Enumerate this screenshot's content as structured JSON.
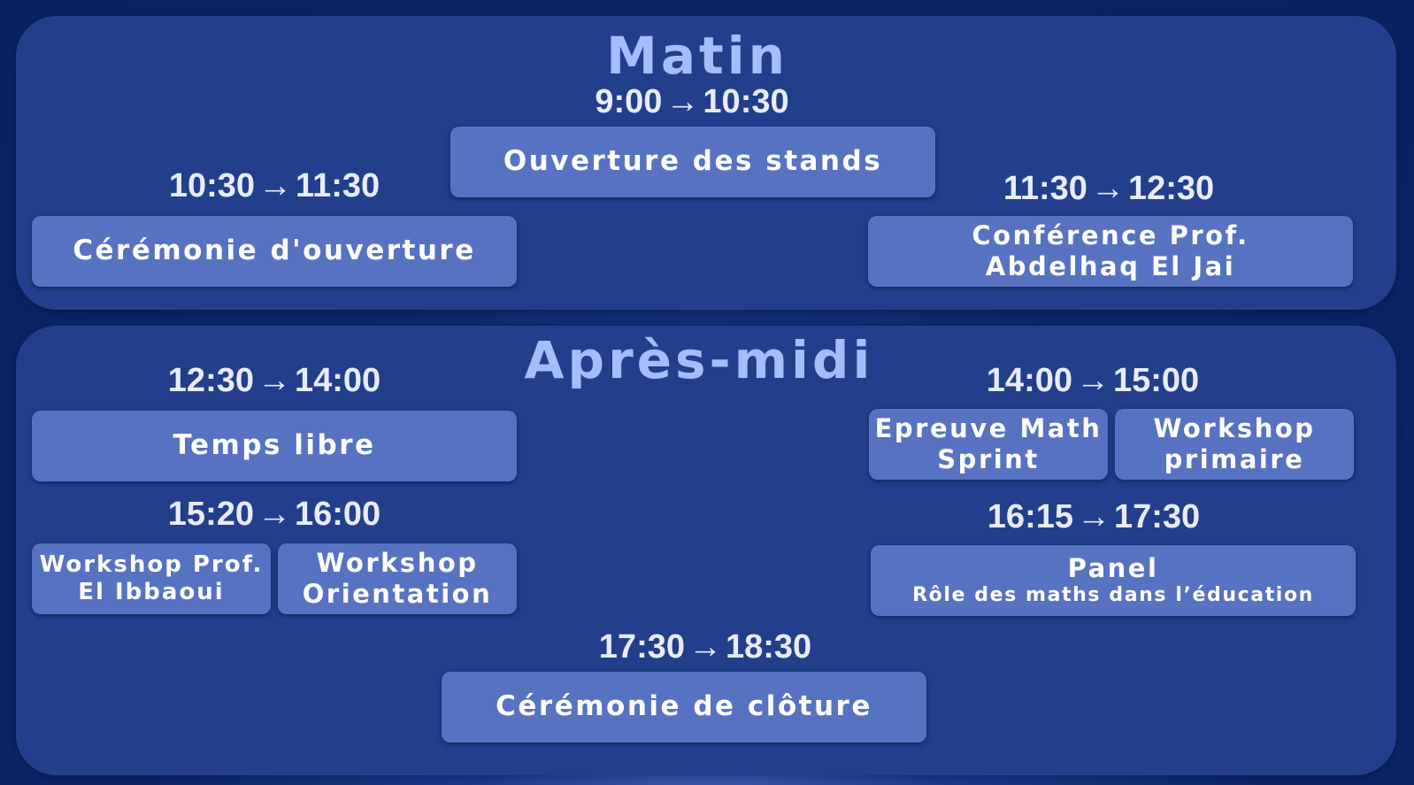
{
  "morning": {
    "title": "Matin",
    "slots": [
      {
        "from": "9:00",
        "arrow": "→",
        "to": "10:30",
        "events": [
          {
            "lines": [
              "Ouverture des stands"
            ]
          }
        ]
      },
      {
        "from": "10:30",
        "arrow": "→",
        "to": "11:30",
        "events": [
          {
            "lines": [
              "Cérémonie d'ouverture"
            ]
          }
        ]
      },
      {
        "from": "11:30",
        "arrow": "→",
        "to": "12:30",
        "events": [
          {
            "lines": [
              "Conférence Prof.",
              "Abdelhaq El Jai"
            ]
          }
        ]
      }
    ]
  },
  "afternoon": {
    "title": "Après-midi",
    "slots": [
      {
        "from": "12:30",
        "arrow": "→",
        "to": "14:00",
        "events": [
          {
            "lines": [
              "Temps libre"
            ]
          }
        ]
      },
      {
        "from": "14:00",
        "arrow": "→",
        "to": "15:00",
        "events": [
          {
            "lines": [
              "Epreuve Math",
              "Sprint"
            ]
          },
          {
            "lines": [
              "Workshop",
              "primaire"
            ]
          }
        ]
      },
      {
        "from": "15:20",
        "arrow": "→",
        "to": "16:00",
        "events": [
          {
            "lines": [
              "Workshop Prof.",
              "El Ibbaoui"
            ]
          },
          {
            "lines": [
              "Workshop",
              "Orientation"
            ]
          }
        ]
      },
      {
        "from": "16:15",
        "arrow": "→",
        "to": "17:30",
        "events": [
          {
            "lines": [
              "Panel",
              "Rôle des maths dans l’éducation"
            ]
          }
        ]
      },
      {
        "from": "17:30",
        "arrow": "→",
        "to": "18:30",
        "events": [
          {
            "lines": [
              "Cérémonie de clôture"
            ]
          }
        ]
      }
    ]
  },
  "colors": {
    "background": "#0c2566",
    "section": "#233f8c",
    "box": "#5772c1",
    "title": "#a5bdfc",
    "time_text": "#e8ecfa",
    "box_text": "#ffffff"
  }
}
